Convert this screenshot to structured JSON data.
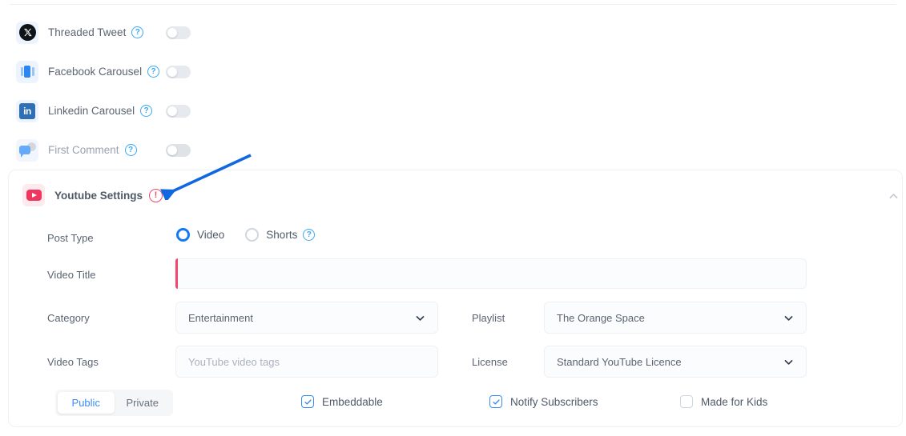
{
  "social_settings": {
    "rows": [
      {
        "label": "Threaded Tweet",
        "icon": "x-twitter-icon",
        "toggle_state": "off",
        "help": "?"
      },
      {
        "label": "Facebook Carousel",
        "icon": "facebook-carousel-icon",
        "toggle_state": "off",
        "help": "?"
      },
      {
        "label": "Linkedin Carousel",
        "icon": "linkedin-icon",
        "toggle_state": "off",
        "help": "?"
      },
      {
        "label": "First Comment",
        "icon": "first-comment-icon",
        "toggle_state": "off",
        "help": "?"
      }
    ]
  },
  "youtube_settings": {
    "title": "Youtube Settings",
    "warning_badge": "!",
    "icon": "youtube-icon",
    "accent_color": "#f0355f",
    "post_type": {
      "label": "Post Type",
      "options": [
        {
          "label": "Video",
          "selected": true
        },
        {
          "label": "Shorts",
          "selected": false
        }
      ],
      "help": "?"
    },
    "video_title": {
      "label": "Video Title",
      "value": "",
      "placeholder": "",
      "required": true,
      "required_color": "#f4456c"
    },
    "category": {
      "label": "Category",
      "value": "Entertainment"
    },
    "playlist": {
      "label": "Playlist",
      "value": "The Orange Space"
    },
    "video_tags": {
      "label": "Video Tags",
      "value": "",
      "placeholder": "YouTube video tags"
    },
    "license": {
      "label": "License",
      "value": "Standard YouTube Licence"
    },
    "visibility": {
      "options": [
        {
          "label": "Public",
          "active": true
        },
        {
          "label": "Private",
          "active": false
        }
      ]
    },
    "checkboxes": [
      {
        "label": "Embeddable",
        "checked": true
      },
      {
        "label": "Notify Subscribers",
        "checked": true
      },
      {
        "label": "Made for Kids",
        "checked": false
      }
    ]
  },
  "annotation": {
    "type": "arrow",
    "color": "#1067e0",
    "points_to": "youtube-settings-warning-icon"
  }
}
